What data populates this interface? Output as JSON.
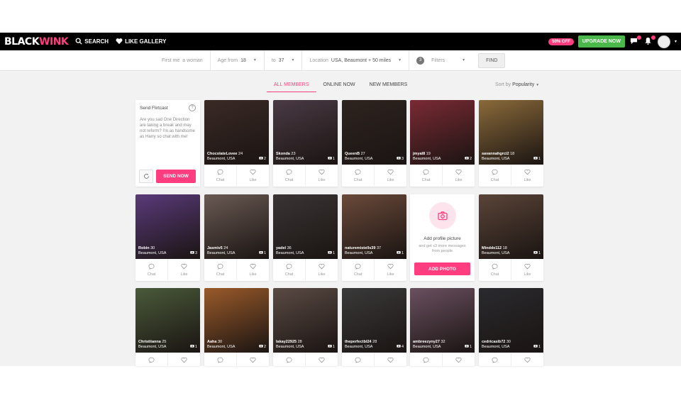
{
  "nav": {
    "logo_black": "BLACK",
    "logo_wink": "WINK",
    "search_label": "SEARCH",
    "like_gallery_label": "LIKE GALLERY",
    "discount": "50% OFF",
    "upgrade": "UPGRADE NOW"
  },
  "filters": {
    "first_me_label": "First me",
    "first_me_value": "a woman",
    "age_from_label": "Age from",
    "age_from_value": "18",
    "to_label": "to",
    "to_value": "37",
    "location_label": "Location",
    "location_value": "USA, Beaumont + 50 miles",
    "filters_count": "3",
    "filters_label": "Filters",
    "find_label": "FIND"
  },
  "tabs": [
    "ALL MEMBERS",
    "ONLINE NOW",
    "NEW MEMBERS"
  ],
  "sort": {
    "label": "Sort by",
    "value": "Popularity"
  },
  "flirtcast": {
    "title": "Send Flirtcast",
    "message": "Are you sad One Direction are taking a break and may not reform? I'm as handsome as Harry so chat with me!",
    "send_label": "SEND NOW"
  },
  "add_photo": {
    "title": "Add profile picture",
    "subtitle": "and get x3 more messages from people",
    "button": "ADD PHOTO"
  },
  "action_labels": {
    "chat": "Chat",
    "like": "Like"
  },
  "members": [
    {
      "name": "ChocolateLovee",
      "age": "24",
      "location": "Beaumont, USA",
      "photos": "2",
      "color": "#3a2a26"
    },
    {
      "name": "Skonda",
      "age": "23",
      "location": "Beaumont, USA",
      "photos": "1",
      "color": "#4a3a44"
    },
    {
      "name": "QueenB",
      "age": "27",
      "location": "Beaumont, USA",
      "photos": "3",
      "color": "#2e2420"
    },
    {
      "name": "jmyal8",
      "age": "19",
      "location": "Beaumont, USA",
      "photos": "2",
      "color": "#7a2a34"
    },
    {
      "name": "savannahgrci2",
      "age": "18",
      "location": "Beaumont, USA",
      "photos": "1",
      "color": "#8a6a3a"
    },
    {
      "name": "Robin",
      "age": "30",
      "location": "Beaumont, USA",
      "photos": "3",
      "color": "#5a3a7a"
    },
    {
      "name": "Jasmiv5",
      "age": "24",
      "location": "Beaumont, USA",
      "photos": "1",
      "color": "#6a5a54"
    },
    {
      "name": "yadel",
      "age": "36",
      "location": "Beaumont, USA",
      "photos": "1",
      "color": "#3a3434"
    },
    {
      "name": "naturemistells39",
      "age": "37",
      "location": "Beaumont, USA",
      "photos": "1",
      "color": "#6a4a3a"
    },
    {
      "name": "Mindde112",
      "age": "18",
      "location": "Beaumont, USA",
      "photos": "1",
      "color": "#5a4438"
    },
    {
      "name": "Christiianna",
      "age": "25",
      "location": "Beaumont, USA",
      "photos": "1",
      "color": "#4a5a3a"
    },
    {
      "name": "Aaha",
      "age": "30",
      "location": "Beaumont, USA",
      "photos": "2",
      "color": "#9a5a2a"
    },
    {
      "name": "lakay22925",
      "age": "28",
      "location": "Beaumont, USA",
      "photos": "1",
      "color": "#5a4a44"
    },
    {
      "name": "theperfectbl24",
      "age": "28",
      "location": "Beaumont, USA",
      "photos": "4",
      "color": "#3a3a3a"
    },
    {
      "name": "ambreezyny27",
      "age": "32",
      "location": "Beaumont, USA",
      "photos": "1",
      "color": "#6a5060"
    },
    {
      "name": "cedricasib72",
      "age": "30",
      "location": "Beaumont, USA",
      "photos": "1",
      "color": "#2a2a2e"
    }
  ]
}
